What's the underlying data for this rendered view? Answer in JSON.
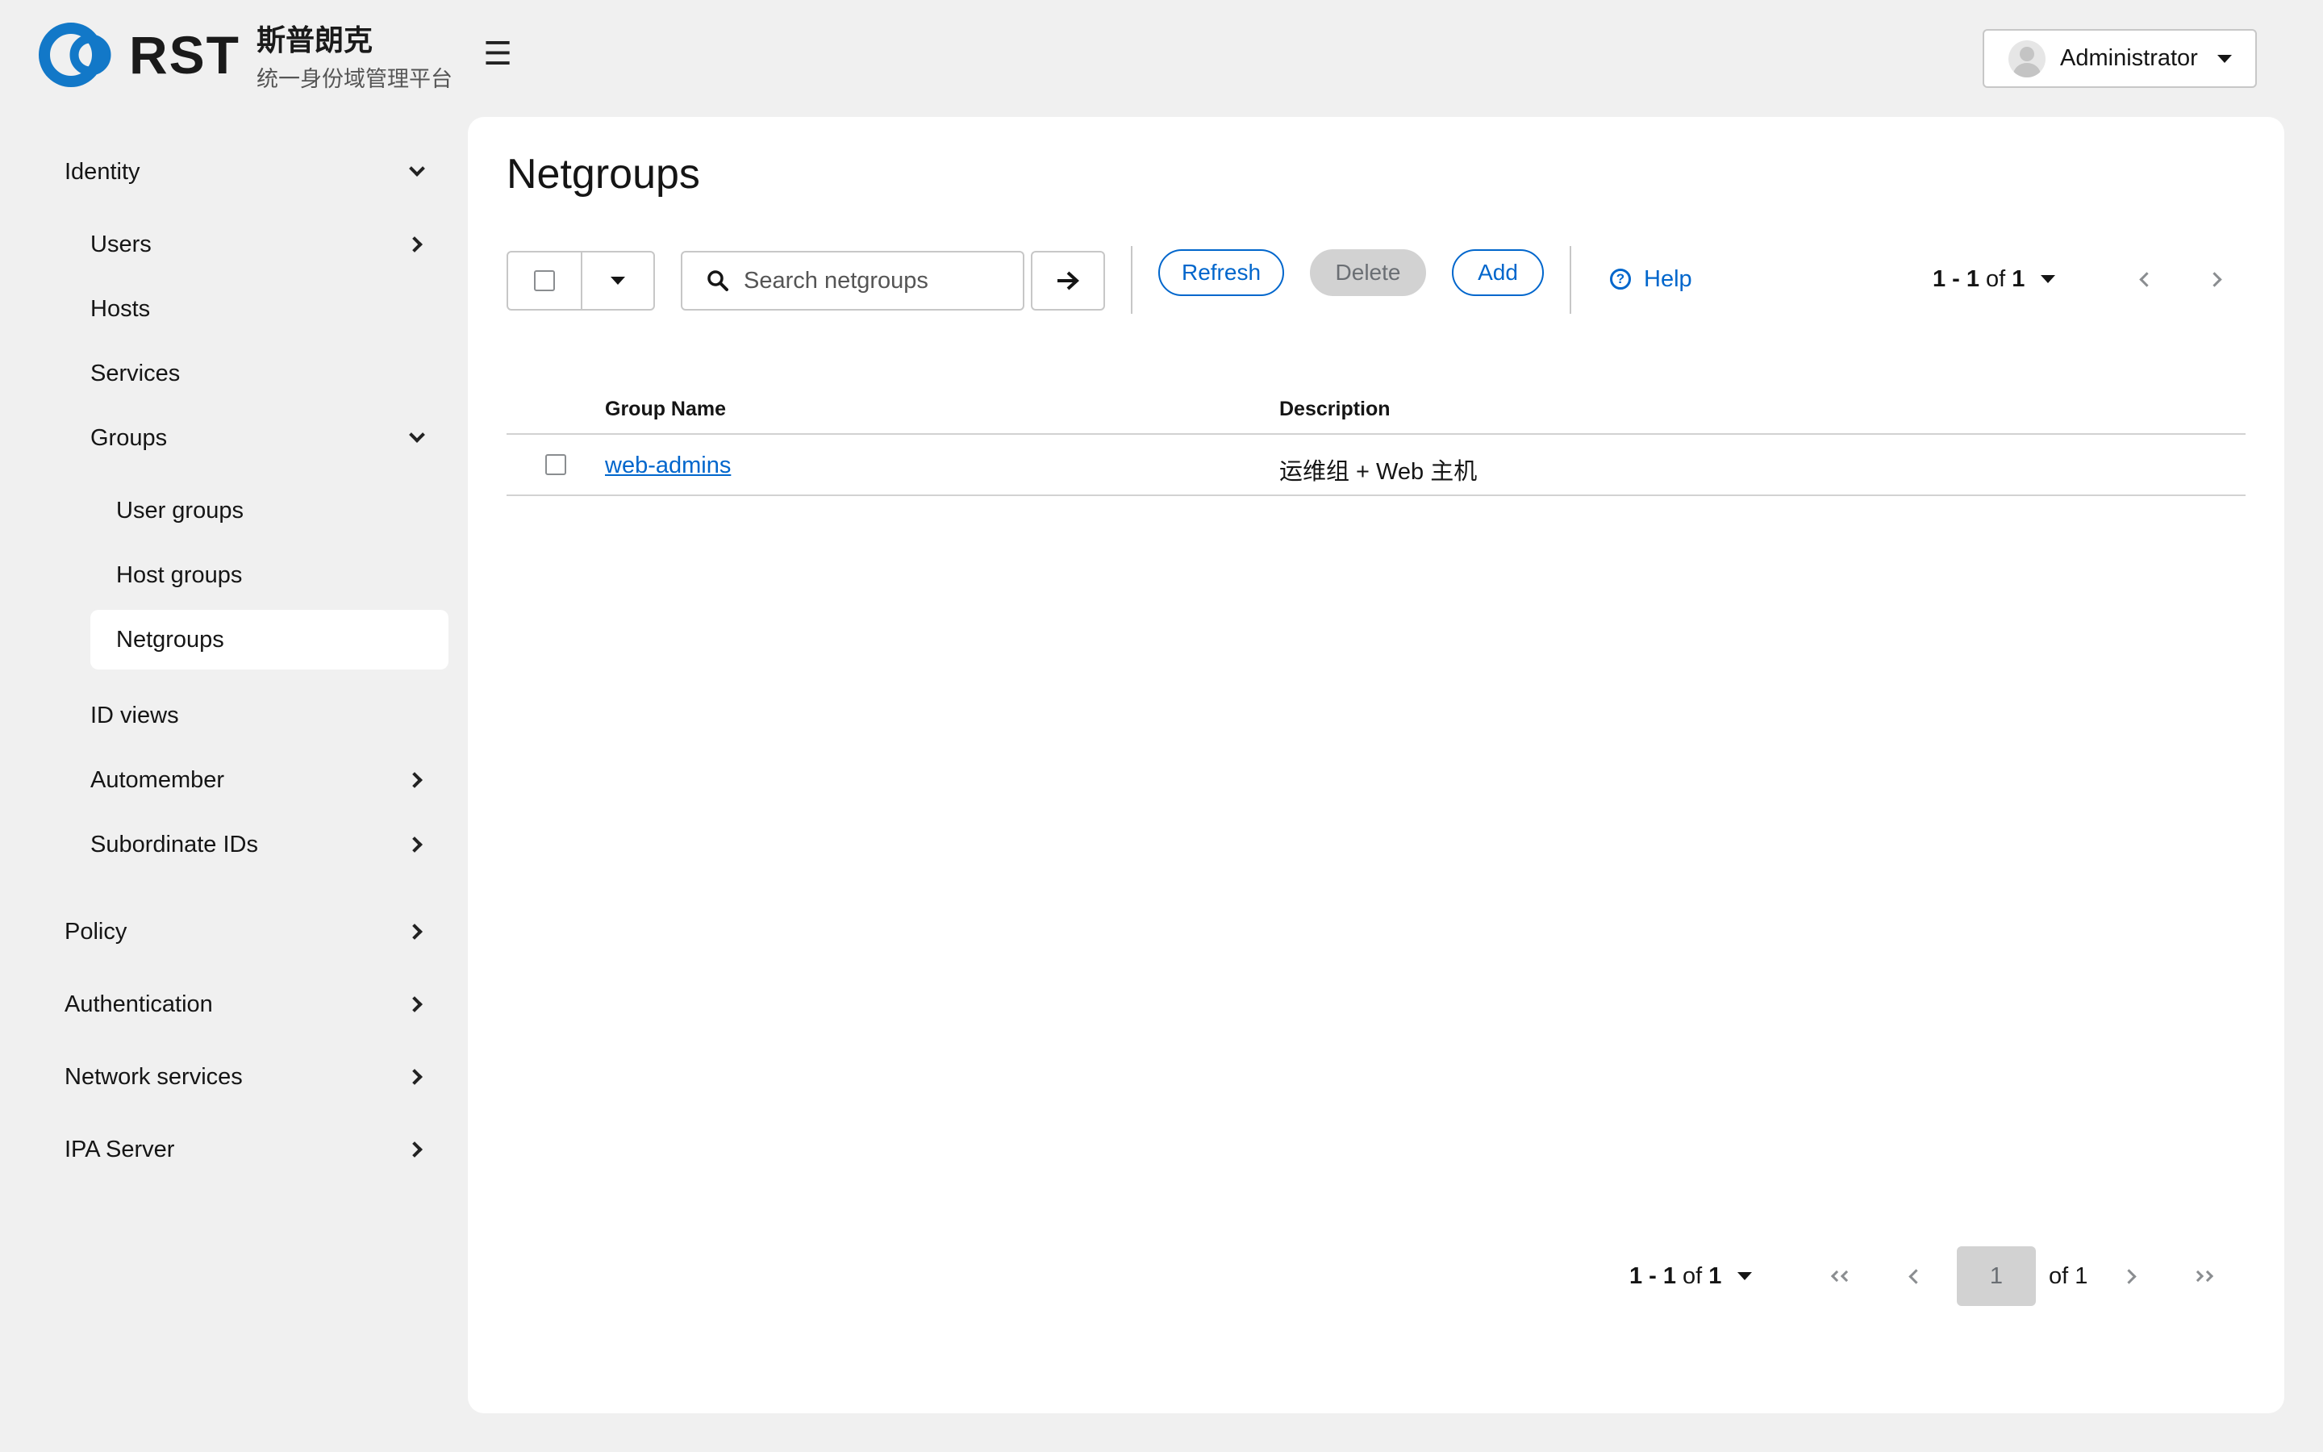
{
  "brand": {
    "logo_text": "RST",
    "name_cn": "斯普朗克",
    "subtitle_cn": "统一身份域管理平台"
  },
  "header": {
    "menu_icon": "hamburger-icon",
    "user_name": "Administrator"
  },
  "sidebar": {
    "identity": "Identity",
    "users": "Users",
    "hosts": "Hosts",
    "services": "Services",
    "groups": "Groups",
    "user_groups": "User groups",
    "host_groups": "Host groups",
    "netgroups": "Netgroups",
    "id_views": "ID views",
    "automember": "Automember",
    "subordinate_ids": "Subordinate IDs",
    "policy": "Policy",
    "authentication": "Authentication",
    "network_services": "Network services",
    "ipa_server": "IPA Server"
  },
  "main": {
    "title": "Netgroups",
    "search_placeholder": "Search netgroups",
    "refresh": "Refresh",
    "delete": "Delete",
    "add": "Add",
    "help": "Help",
    "pager": {
      "range": "1 - 1",
      "of_word": "of",
      "total": "1",
      "page": "1",
      "of_pages": "of 1"
    },
    "table": {
      "columns": [
        "Group Name",
        "Description"
      ],
      "rows": [
        {
          "name": "web-admins",
          "description": "运维组 + Web 主机"
        }
      ]
    }
  },
  "colors": {
    "link": "#0066cc",
    "background": "#f0f0f0",
    "panel": "#ffffff"
  }
}
